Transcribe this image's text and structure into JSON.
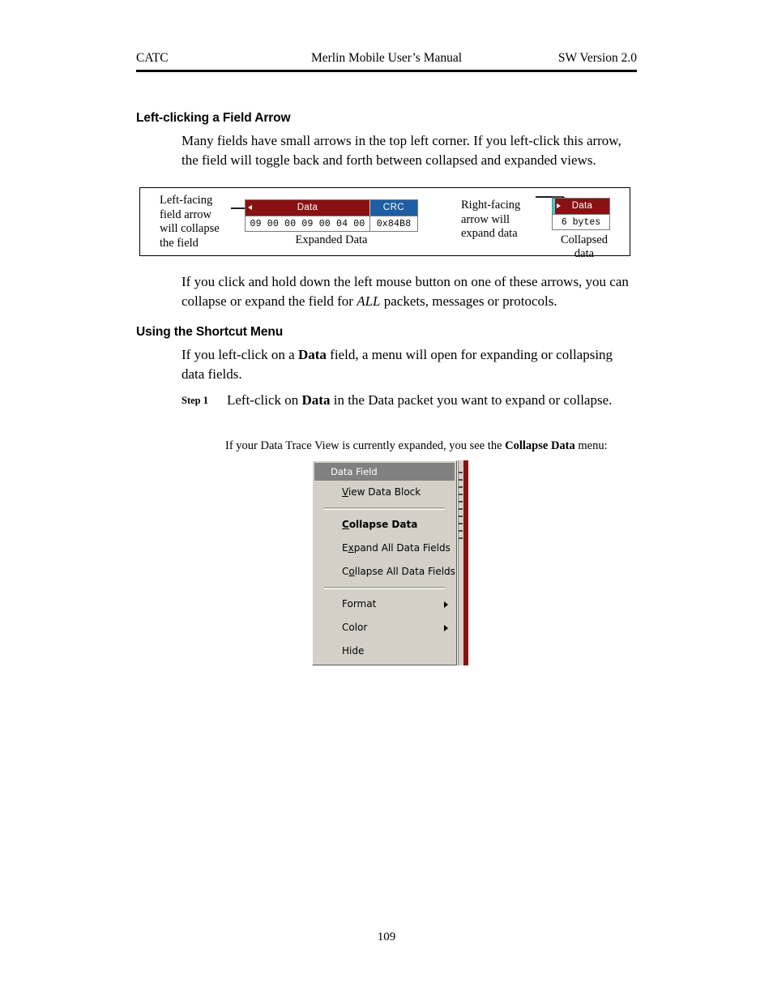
{
  "header": {
    "left": "CATC",
    "center": "Merlin Mobile User’s Manual",
    "right": "SW Version 2.0"
  },
  "sections": {
    "heading_1": "Left-clicking a Field Arrow",
    "paragraph_1": "Many fields have small arrows in the top left corner.  If you left-click this arrow, the field will toggle back and forth between collapsed and expanded views.",
    "paragraph_2_part1": "If you click and hold down the left mouse button on one of these arrows, you can collapse or expand the field for ",
    "paragraph_2_emphasis": "ALL",
    "paragraph_2_part2": " packets, messages or protocols.",
    "heading_2": "Using the Shortcut Menu",
    "paragraph_3_part1": "If you left-click on a ",
    "paragraph_3_bold": "Data",
    "paragraph_3_part2": " field, a menu will open for expanding or collapsing data fields."
  },
  "step": {
    "label": "Step 1",
    "text_part1": "Left-click on ",
    "text_bold": "Data",
    "text_part2": " in the Data packet you want to expand or collapse."
  },
  "sub_note": {
    "part1": "If your Data Trace View is currently expanded, you see the ",
    "bold": "Collapse Data",
    "part2": " menu:"
  },
  "figure": {
    "callout_left": "Left-facing\nfield arrow\nwill collapse\nthe field",
    "callout_left_lines": [
      "Left-facing",
      "field arrow",
      "will collapse",
      "the field"
    ],
    "callout_right_lines": [
      "Right-facing",
      "arrow will",
      "expand data"
    ],
    "caption_expanded": "Expanded Data",
    "caption_collapsed_lines": [
      "Collapsed",
      "data"
    ],
    "expanded_widget": {
      "data_header": "Data",
      "crc_header": "CRC",
      "data_bytes": "09  00  00  09  00  04  00",
      "crc_value": "0x84B8",
      "data_color": "#8a1111",
      "crc_color": "#1d5ea4"
    },
    "collapsed_widget": {
      "data_header": "Data",
      "size_value": "6 bytes",
      "data_color": "#8a1111",
      "arrow_accent_color": "#2fd8d8"
    }
  },
  "context_menu": {
    "title": "Data Field",
    "items": [
      {
        "label": "View Data Block",
        "accel": "V",
        "bold": false,
        "submenu": false
      },
      {
        "label": "Collapse Data",
        "accel": "C",
        "bold": true,
        "submenu": false
      },
      {
        "label": "Expand All Data Fields",
        "accel": "x",
        "bold": false,
        "submenu": false
      },
      {
        "label": "Collapse All Data Fields",
        "accel": "o",
        "bold": false,
        "submenu": false
      },
      {
        "label": "Format",
        "accel": "",
        "bold": false,
        "submenu": true
      },
      {
        "label": "Color",
        "accel": "",
        "bold": false,
        "submenu": true
      },
      {
        "label": "Hide",
        "accel": "",
        "bold": false,
        "submenu": false
      }
    ],
    "title_bg": "#808080",
    "menu_bg": "#d4d0c8"
  },
  "footer": {
    "page_number": "109"
  }
}
